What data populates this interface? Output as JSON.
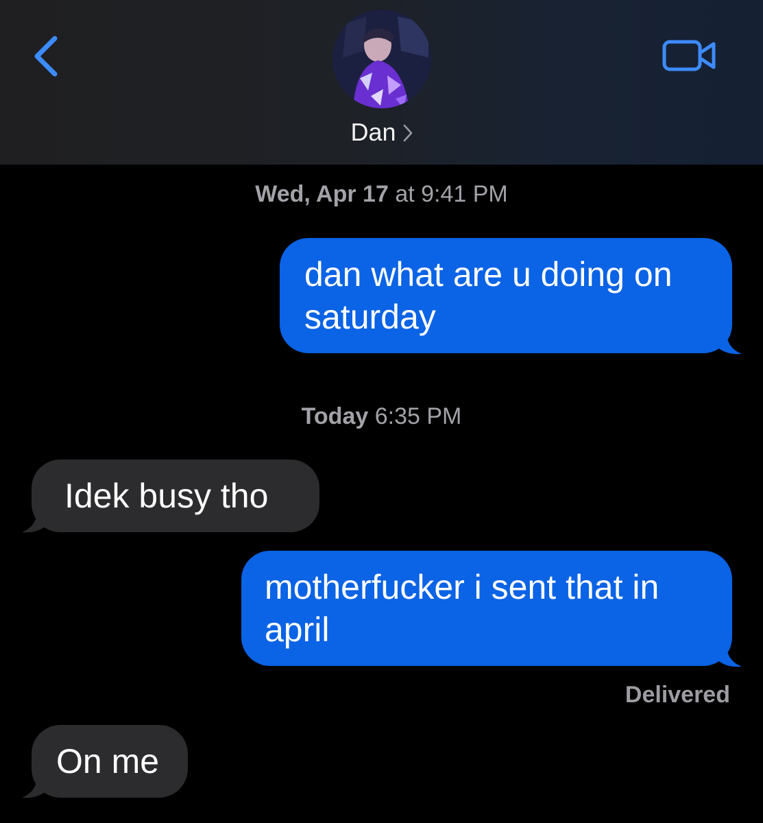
{
  "header": {
    "contact_name": "Dan",
    "back_icon": "chevron-left-icon",
    "video_icon": "video-camera-icon",
    "accent_color": "#3d8bfd",
    "background_color": "#1e2126"
  },
  "thread": {
    "timestamp_1": {
      "day": "Wed, Apr 17",
      "time": "at 9:41 PM"
    },
    "timestamp_2": {
      "day": "Today",
      "time": "6:35 PM"
    },
    "messages": [
      {
        "from": "me",
        "text": "dan what are u doing on saturday"
      },
      {
        "from": "contact",
        "text": "Idek busy tho"
      },
      {
        "from": "me",
        "text": "motherfucker i sent that in april"
      },
      {
        "from": "contact",
        "text": "On me"
      }
    ],
    "delivery_status": "Delivered",
    "sent_color": "#0b63e5",
    "received_color": "#2c2c2e"
  }
}
